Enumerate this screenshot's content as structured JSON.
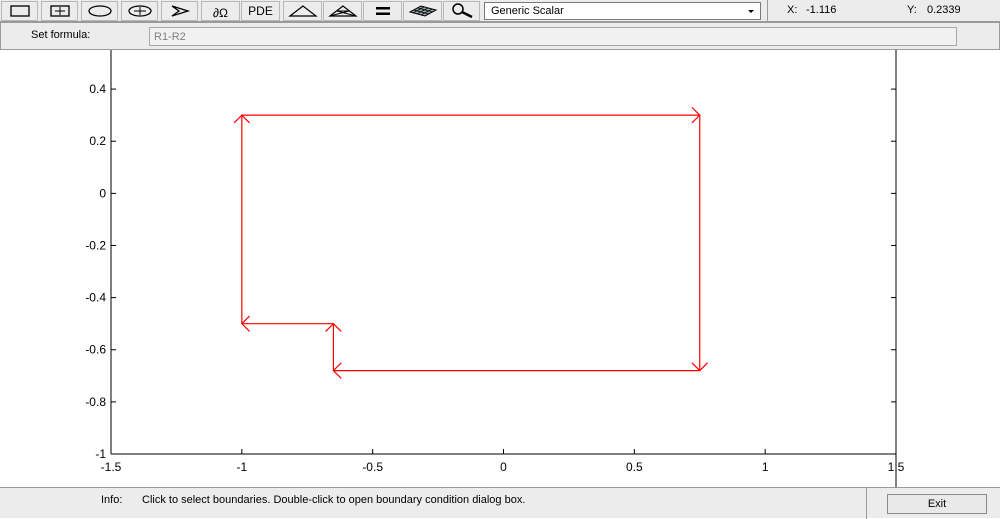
{
  "toolbar": {
    "buttons": [
      {
        "name": "rectangle-tool-button",
        "icon": "rectangle-icon"
      },
      {
        "name": "centered-rectangle-tool-button",
        "icon": "centered-rectangle-icon"
      },
      {
        "name": "ellipse-tool-button",
        "icon": "ellipse-icon"
      },
      {
        "name": "centered-ellipse-tool-button",
        "icon": "centered-ellipse-icon"
      },
      {
        "name": "polygon-tool-button",
        "icon": "polygon-icon"
      },
      {
        "name": "boundary-mode-button",
        "icon": "boundary-icon"
      },
      {
        "name": "pde-button",
        "label": "PDE"
      },
      {
        "name": "init-mesh-button",
        "icon": "triangle-icon"
      },
      {
        "name": "refine-mesh-button",
        "icon": "refine-triangle-icon"
      },
      {
        "name": "solve-button",
        "icon": "equals-icon"
      },
      {
        "name": "plot-solution-button",
        "icon": "surface-plot-icon"
      },
      {
        "name": "zoom-button",
        "icon": "magnifier-icon"
      }
    ],
    "boundary_label": "∂Ω",
    "pde_label": "PDE",
    "mode_select": {
      "value": "Generic Scalar"
    }
  },
  "coords": {
    "x_label": "X:",
    "x_value": "-1.116",
    "y_label": "Y:",
    "y_value": "0.2339"
  },
  "formula": {
    "label": "Set formula:",
    "value": "R1-R2"
  },
  "plot": {
    "x_ticks": [
      "-1.5",
      "-1",
      "-0.5",
      "0",
      "0.5",
      "1",
      "1.5"
    ],
    "y_ticks": [
      "0.4",
      "0.2",
      "0",
      "-0.2",
      "-0.4",
      "-0.6",
      "-0.8",
      "-1"
    ],
    "xlim": [
      -1.5,
      1.5
    ],
    "ylim": [
      -1,
      0.55
    ],
    "boundary_color": "#ff0000",
    "boundary_polygon": [
      [
        -1,
        0.3
      ],
      [
        0.75,
        0.3
      ],
      [
        0.75,
        -0.68
      ],
      [
        -0.65,
        -0.68
      ],
      [
        -0.65,
        -0.5
      ],
      [
        -1,
        -0.5
      ]
    ]
  },
  "info": {
    "label": "Info:",
    "text": "Click to select boundaries. Double-click to open boundary condition dialog box."
  },
  "exit_label": "Exit"
}
